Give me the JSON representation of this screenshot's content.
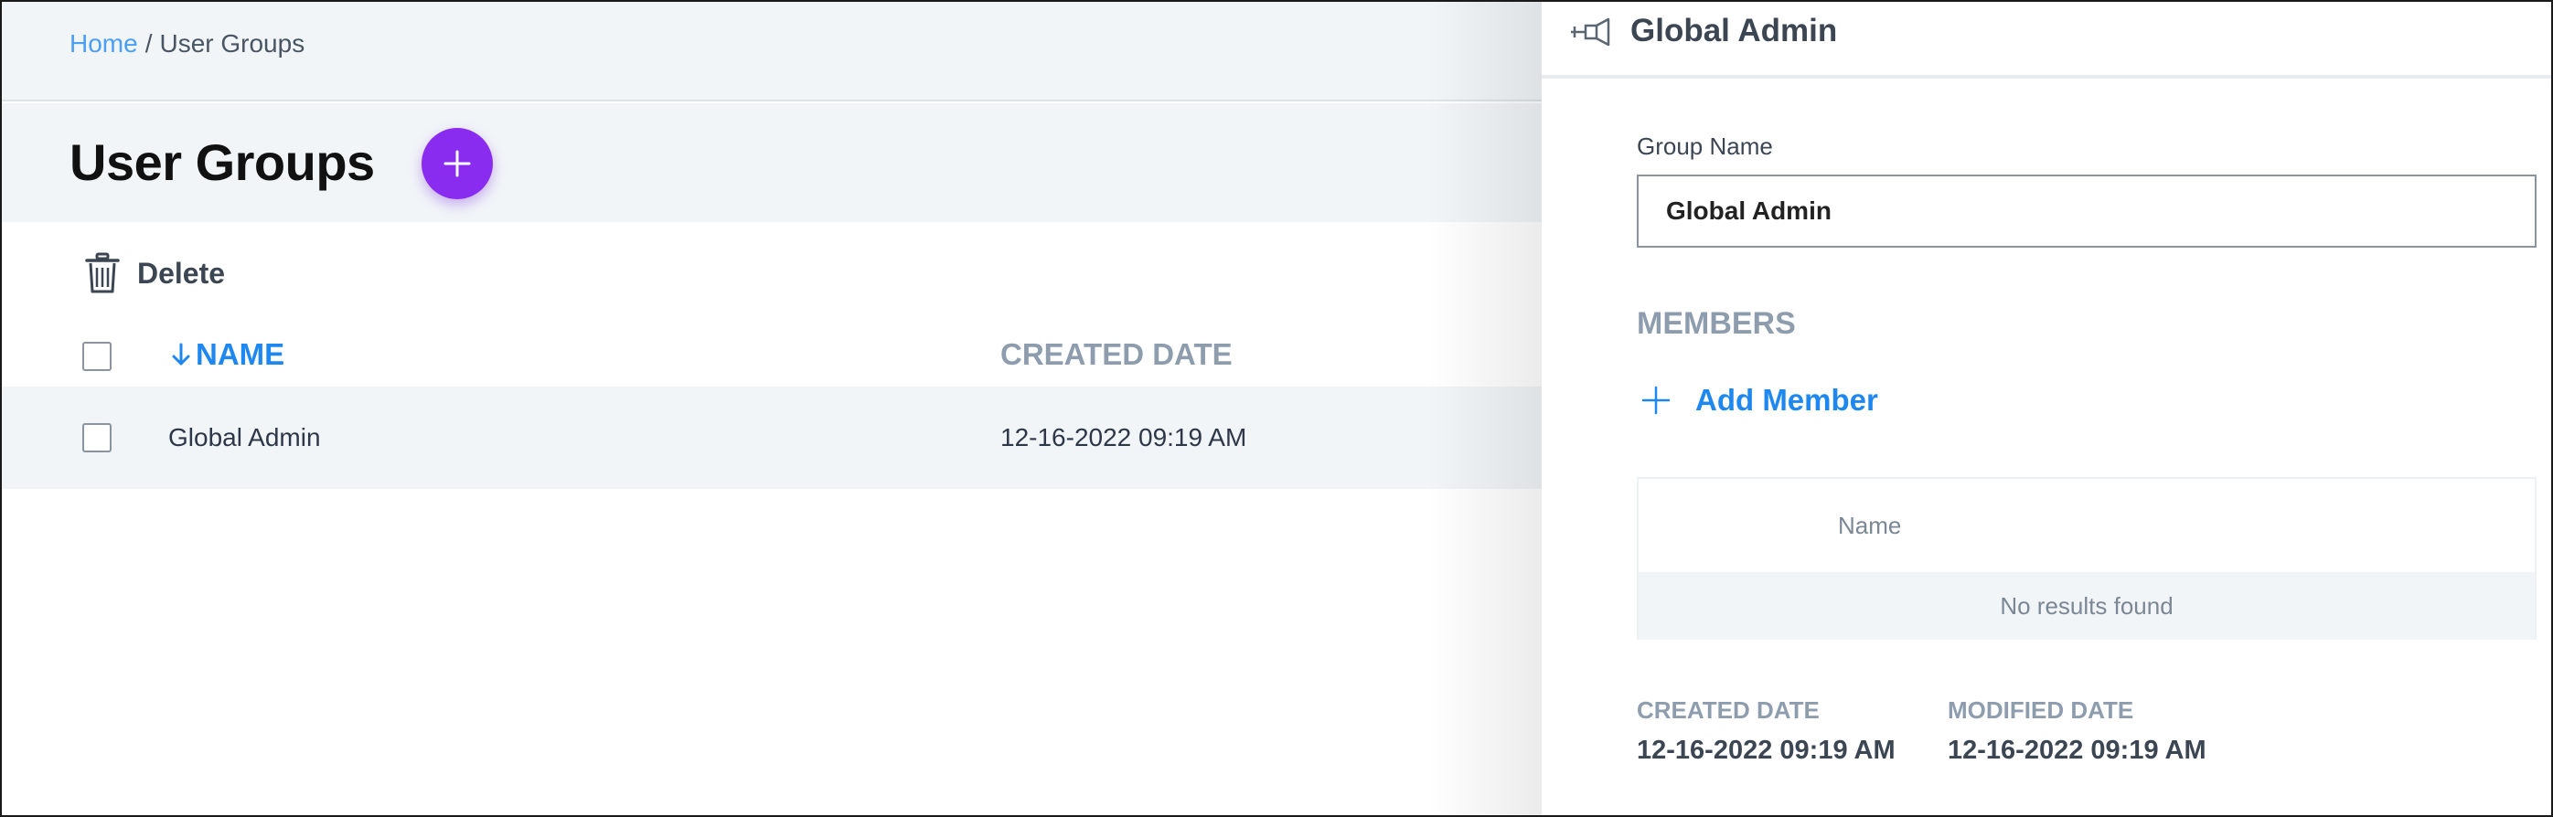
{
  "breadcrumb": {
    "home": "Home",
    "separator": "/",
    "current": "User Groups"
  },
  "page": {
    "title": "User Groups",
    "add_button_icon": "plus-icon"
  },
  "toolbar": {
    "delete_label": "Delete",
    "delete_icon": "trash-icon"
  },
  "table": {
    "columns": [
      {
        "label": "NAME",
        "sorted": "descending",
        "sort_icon": "arrow-down-icon"
      },
      {
        "label": "CREATED DATE"
      }
    ],
    "rows": [
      {
        "name": "Global Admin",
        "created_date": "12-16-2022 09:19 AM"
      }
    ]
  },
  "panel": {
    "title": "Global Admin",
    "header_icon": "collapse-panel-icon",
    "group_name_label": "Group Name",
    "group_name_value": "Global Admin",
    "members_heading": "MEMBERS",
    "add_member_label": "Add Member",
    "members_table": {
      "columns": [
        "Name"
      ],
      "empty_text": "No results found"
    },
    "created_date_label": "CREATED DATE",
    "created_date_value": "12-16-2022 09:19 AM",
    "modified_date_label": "MODIFIED DATE",
    "modified_date_value": "12-16-2022 09:19 AM"
  },
  "colors": {
    "accent_purple": "#8a2cf0",
    "link_blue": "#1e88f0",
    "header_bg": "#f1f5f8",
    "muted_label": "#8e9dae"
  }
}
